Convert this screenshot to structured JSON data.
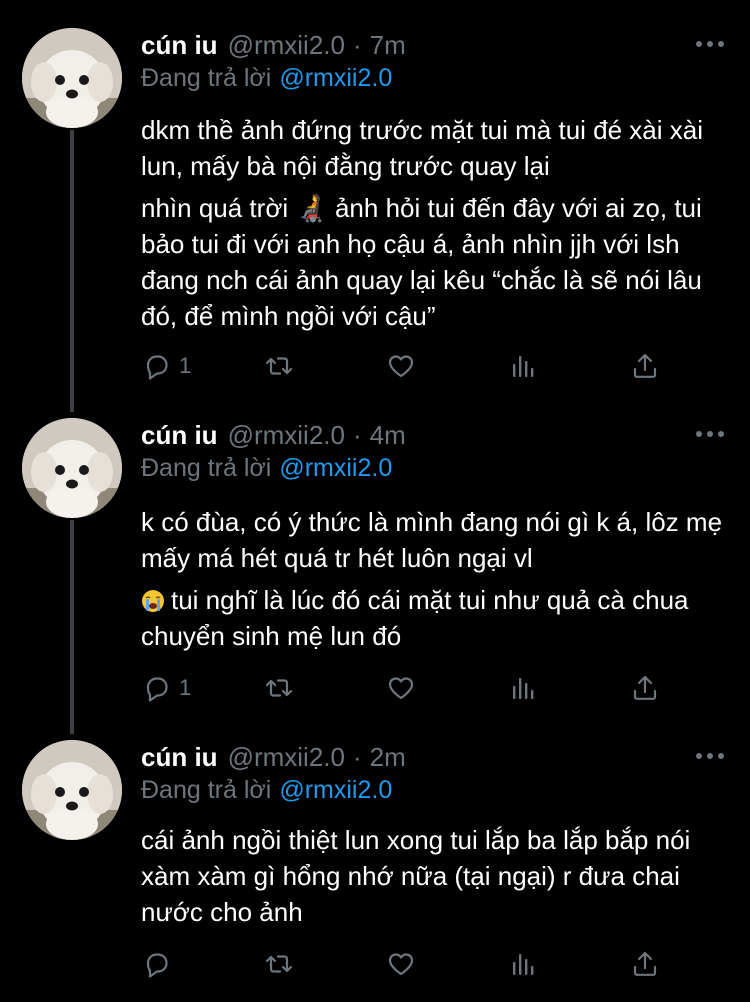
{
  "colors": {
    "background": "#000000",
    "text": "#ffffff",
    "secondary": "#6e767d",
    "mention": "#1d9bf0",
    "thread_line": "#3d4145"
  },
  "tweets": [
    {
      "name": "cún iu",
      "handle": "@rmxii2.0",
      "separator": "·",
      "time": "7m",
      "reply_prefix": "Đang trả lời",
      "reply_to": "@rmxii2.0",
      "paragraphs": [
        "dkm thề ảnh đứng trước mặt tui mà tui đé xài xài lun, mấy bà nội đằng trước quay lại",
        "nhìn quá trời 🧑‍🦼 ảnh hỏi tui đến đây với ai zọ, tui bảo tui đi với anh họ cậu á, ảnh nhìn jjh với lsh đang nch cái ảnh quay lại kêu “chắc là sẽ nói lâu đó, để mình ngồi với cậu”"
      ],
      "reply_count": "1",
      "icons": [
        "reply-icon",
        "retweet-icon",
        "like-icon",
        "analytics-icon",
        "share-icon"
      ]
    },
    {
      "name": "cún iu",
      "handle": "@rmxii2.0",
      "separator": "·",
      "time": "4m",
      "reply_prefix": "Đang trả lời",
      "reply_to": "@rmxii2.0",
      "paragraphs": [
        "k có đùa, có ý thức là mình đang nói gì k á, lôz mẹ mấy má hét quá tr hét luôn ngại vl",
        "tui nghĩ là lúc đó cái mặt tui như quả cà chua chuyển sinh mệ lun đó"
      ],
      "emoji_prefix": "loudly-crying-face-emoji",
      "reply_count": "1",
      "icons": [
        "reply-icon",
        "retweet-icon",
        "like-icon",
        "analytics-icon",
        "share-icon"
      ]
    },
    {
      "name": "cún iu",
      "handle": "@rmxii2.0",
      "separator": "·",
      "time": "2m",
      "reply_prefix": "Đang trả lời",
      "reply_to": "@rmxii2.0",
      "paragraphs": [
        "cái ảnh ngồi thiệt lun xong tui lắp ba lắp bắp nói xàm xàm gì hổng nhớ nữa (tại ngại) r đưa chai nước cho ảnh"
      ],
      "reply_count": "",
      "icons": [
        "reply-icon",
        "retweet-icon",
        "like-icon",
        "analytics-icon",
        "share-icon"
      ]
    }
  ]
}
